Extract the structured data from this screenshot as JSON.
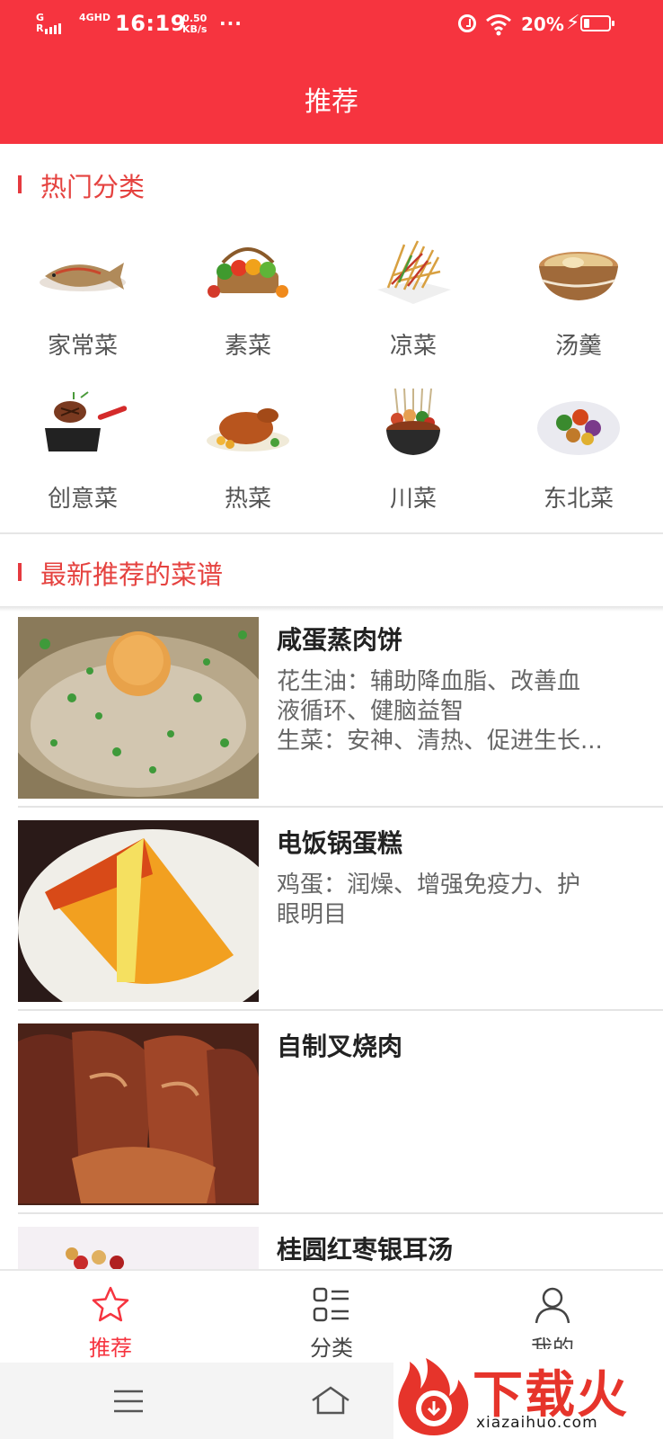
{
  "status_bar": {
    "signal1": "G",
    "signal2": "4GHD",
    "time": "16:19",
    "speed_value": "0.50",
    "speed_unit": "KB/s",
    "more": "···",
    "battery_percent": "20%"
  },
  "header": {
    "title": "推荐"
  },
  "hot_categories": {
    "title": "热门分类",
    "items": [
      {
        "label": "家常菜",
        "icon": "fish-dish-icon"
      },
      {
        "label": "素菜",
        "icon": "vegetable-basket-icon"
      },
      {
        "label": "凉菜",
        "icon": "cold-salad-icon"
      },
      {
        "label": "汤羹",
        "icon": "soup-pot-icon"
      },
      {
        "label": "创意菜",
        "icon": "grill-pan-icon"
      },
      {
        "label": "热菜",
        "icon": "roast-chicken-icon"
      },
      {
        "label": "川菜",
        "icon": "hotpot-skewers-icon"
      },
      {
        "label": "东北菜",
        "icon": "stir-fry-plate-icon"
      }
    ]
  },
  "recommend": {
    "title": "最新推荐的菜谱",
    "recipes": [
      {
        "name": "咸蛋蒸肉饼",
        "desc": [
          "花生油：辅助降血脂、改善血",
          "液循环、健脑益智",
          "生菜：安神、清热、促进生长..."
        ]
      },
      {
        "name": "电饭锅蛋糕",
        "desc": [
          "鸡蛋：润燥、增强免疫力、护",
          "眼明目"
        ]
      },
      {
        "name": "自制叉烧肉",
        "desc": []
      },
      {
        "name": "桂圆红枣银耳汤",
        "desc": []
      }
    ]
  },
  "tabs": [
    {
      "label": "推荐",
      "icon": "star-icon",
      "active": true
    },
    {
      "label": "分类",
      "icon": "list-grid-icon",
      "active": false
    },
    {
      "label": "我的",
      "icon": "user-icon",
      "active": false
    }
  ],
  "watermark": {
    "text": "下载火",
    "url": "xiazaihuo.com"
  },
  "colors": {
    "primary": "#f6343f",
    "section_title": "#e5423f"
  }
}
